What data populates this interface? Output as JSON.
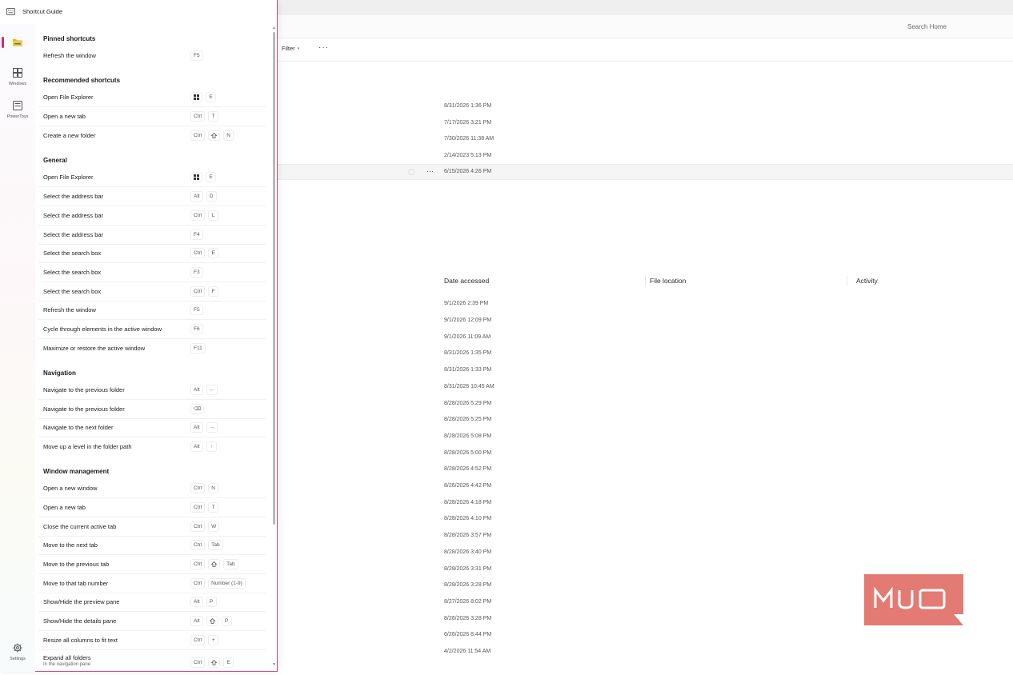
{
  "explorer": {
    "search_placeholder": "Search Home",
    "toolbar": {
      "filter_label": "Filter",
      "more_label": "···"
    },
    "recent_dates": [
      "8/31/2026 1:36 PM",
      "7/17/2026 3:21 PM",
      "7/30/2026 11:38 AM",
      "2/14/2023 5:13 PM",
      "6/15/2026 4:26 PM"
    ],
    "columns": {
      "date_accessed": "Date accessed",
      "file_location": "File location",
      "activity": "Activity"
    },
    "list_dates": [
      "9/1/2026 2:39 PM",
      "9/1/2026 12:09 PM",
      "9/1/2026 11:09 AM",
      "8/31/2026 1:35 PM",
      "8/31/2026 1:33 PM",
      "8/31/2026 10:45 AM",
      "8/28/2026 5:29 PM",
      "8/28/2026 5:25 PM",
      "8/28/2026 5:08 PM",
      "8/28/2026 5:00 PM",
      "8/28/2026 4:52 PM",
      "8/26/2026 4:42 PM",
      "8/28/2026 4:18 PM",
      "8/28/2026 4:10 PM",
      "8/28/2026 3:57 PM",
      "8/28/2026 3:40 PM",
      "8/28/2026 3:31 PM",
      "8/28/2026 3:28 PM",
      "8/27/2026 8:02 PM",
      "8/26/2026 3:28 PM",
      "6/26/2026 8:44 PM",
      "4/2/2026 11:54 AM"
    ],
    "watermark": "MUO"
  },
  "guide": {
    "title": "Shortcut Guide",
    "nav": [
      {
        "label": "",
        "icon": "file-explorer-icon"
      },
      {
        "label": "Windows",
        "icon": "windows-icon"
      },
      {
        "label": "PowerToys",
        "icon": "powertoys-icon"
      },
      {
        "label": "Settings",
        "icon": "gear-icon"
      }
    ],
    "sections": [
      {
        "title": "Pinned shortcuts",
        "items": [
          {
            "label": "Refresh the window",
            "keys": [
              "F5"
            ]
          }
        ]
      },
      {
        "title": "Recommended shortcuts",
        "items": [
          {
            "label": "Open File Explorer",
            "keys": [
              "win",
              "E"
            ]
          },
          {
            "label": "Open a new tab",
            "keys": [
              "Ctrl",
              "T"
            ]
          },
          {
            "label": "Create a new folder",
            "keys": [
              "Ctrl",
              "shift",
              "N"
            ]
          }
        ]
      },
      {
        "title": "General",
        "items": [
          {
            "label": "Open File Explorer",
            "keys": [
              "win",
              "E"
            ]
          },
          {
            "label": "Select the address bar",
            "keys": [
              "Alt",
              "D"
            ]
          },
          {
            "label": "Select the address bar",
            "keys": [
              "Ctrl",
              "L"
            ]
          },
          {
            "label": "Select the address bar",
            "keys": [
              "F4"
            ]
          },
          {
            "label": "Select the search box",
            "keys": [
              "Ctrl",
              "E"
            ]
          },
          {
            "label": "Select the search box",
            "keys": [
              "F3"
            ]
          },
          {
            "label": "Select the search box",
            "keys": [
              "Ctrl",
              "F"
            ]
          },
          {
            "label": "Refresh the window",
            "keys": [
              "F5"
            ]
          },
          {
            "label": "Cycle through elements in the active window",
            "keys": [
              "F6"
            ]
          },
          {
            "label": "Maximize or restore the active window",
            "keys": [
              "F11"
            ]
          }
        ]
      },
      {
        "title": "Navigation",
        "items": [
          {
            "label": "Navigate to the previous folder",
            "keys": [
              "Alt",
              "←"
            ]
          },
          {
            "label": "Navigate to the previous folder",
            "keys": [
              "⌫"
            ]
          },
          {
            "label": "Navigate to the next folder",
            "keys": [
              "Alt",
              "→"
            ]
          },
          {
            "label": "Move up a level in the folder path",
            "keys": [
              "Alt",
              "↑"
            ]
          }
        ]
      },
      {
        "title": "Window management",
        "items": [
          {
            "label": "Open a new window",
            "keys": [
              "Ctrl",
              "N"
            ]
          },
          {
            "label": "Open a new tab",
            "keys": [
              "Ctrl",
              "T"
            ]
          },
          {
            "label": "Close the current active tab",
            "keys": [
              "Ctrl",
              "W"
            ]
          },
          {
            "label": "Move to the next tab",
            "keys": [
              "Ctrl",
              "Tab"
            ]
          },
          {
            "label": "Move to the previous tab",
            "keys": [
              "Ctrl",
              "shift",
              "Tab"
            ]
          },
          {
            "label": "Move to that tab number",
            "keys": [
              "Ctrl",
              "Number (1-9)"
            ]
          },
          {
            "label": "Show/Hide the preview pane",
            "keys": [
              "Alt",
              "P"
            ]
          },
          {
            "label": "Show/Hide the details pane",
            "keys": [
              "Alt",
              "shift",
              "P"
            ]
          },
          {
            "label": "Resize all columns to fit text",
            "keys": [
              "Ctrl",
              "+"
            ]
          },
          {
            "label": "Expand all folders",
            "sublabel": "In the navigation pane",
            "keys": [
              "Ctrl",
              "shift",
              "E"
            ]
          }
        ]
      }
    ],
    "colors": {
      "accent": "#c4317c",
      "border": "#d14b8a",
      "watermark": "#e37a73"
    }
  }
}
